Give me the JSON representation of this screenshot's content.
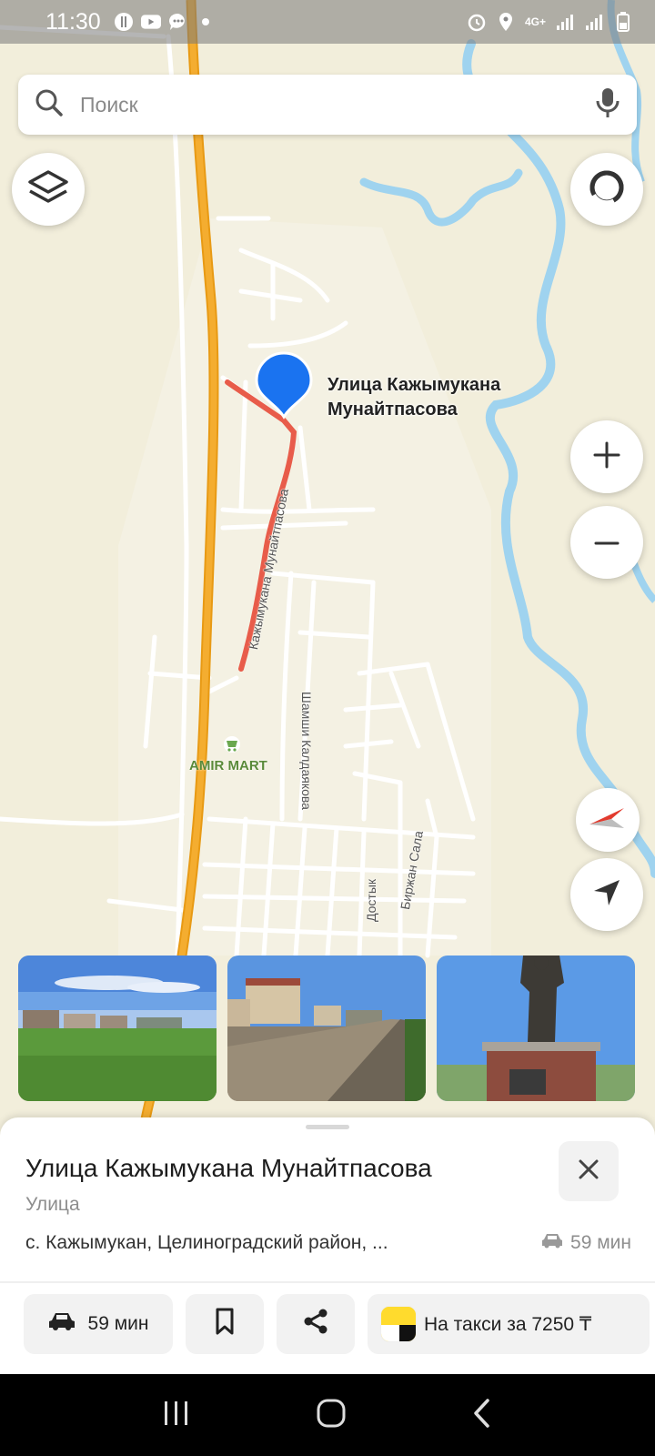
{
  "status_bar": {
    "time": "11:30",
    "network": "4G+"
  },
  "search": {
    "placeholder": "Поиск"
  },
  "map": {
    "pin_label_line1": "Улица Кажымукана",
    "pin_label_line2": "Мунайтпасова",
    "poi_label": "AMIR MART",
    "streets": {
      "main": "Кажымукана Мунайтпасова",
      "s1": "Шамши Калдаякова",
      "s2": "Достык",
      "s3": "Биржан Сала"
    }
  },
  "sheet": {
    "title": "Улица Кажымукана Мунайтпасова",
    "type": "Улица",
    "address": "с. Кажымукан, Целиноградский район, ...",
    "eta": "59 мин"
  },
  "actions": {
    "route_label": "59 мин",
    "taxi_label": "На такси за 7250 ₸"
  },
  "colors": {
    "map_bg": "#f2eedb",
    "water": "#9fd3ef",
    "highway": "#f3a21a",
    "route": "#e85c4a",
    "pin": "#1a73f0"
  },
  "icons": [
    "search-icon",
    "microphone-icon",
    "layers-icon",
    "compass-ring-icon",
    "plus-icon",
    "minus-icon",
    "compass-icon",
    "locate-icon",
    "close-icon",
    "car-icon",
    "bookmark-icon",
    "share-icon",
    "taxi-logo"
  ]
}
